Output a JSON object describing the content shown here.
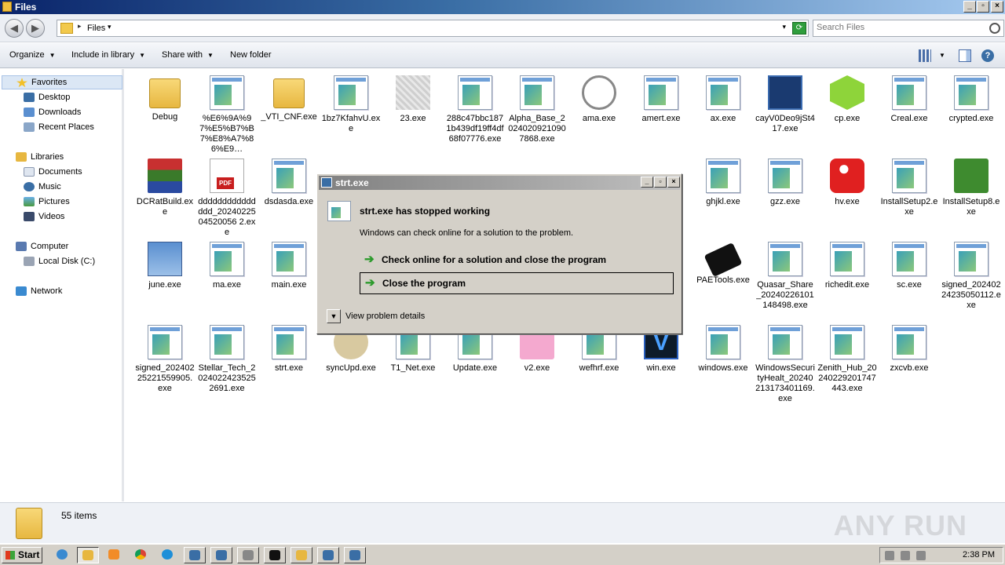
{
  "window": {
    "title": "Files"
  },
  "address": {
    "crumb": "Files",
    "search_placeholder": "Search Files"
  },
  "toolbar": {
    "organize": "Organize",
    "include": "Include in library",
    "share": "Share with",
    "new_folder": "New folder"
  },
  "sidebar": {
    "favorites": "Favorites",
    "desktop": "Desktop",
    "downloads": "Downloads",
    "recent": "Recent Places",
    "libraries": "Libraries",
    "documents": "Documents",
    "music": "Music",
    "pictures": "Pictures",
    "videos": "Videos",
    "computer": "Computer",
    "local_disk": "Local Disk (C:)",
    "network": "Network"
  },
  "files": [
    "Debug",
    "%E6%9A%97%E5%B7%B7%E8%A7%86%E9…",
    "_VTI_CNF.exe",
    "1bz7KfahvU.exe",
    "23.exe",
    "288c47bbc1871b439df19ff4df68f07776.exe",
    "Alpha_Base_20240209210907868.exe",
    "ama.exe",
    "amert.exe",
    "ax.exe",
    "cayV0Deo9jSt417.exe",
    "cp.exe",
    "Creal.exe",
    "crypted.exe",
    "DCRatBuild.exe",
    "ddddddddddddddd_2024022504520056 2.exe",
    "dsdasda.exe",
    "ghjkl.exe",
    "gzz.exe",
    "hv.exe",
    "InstallSetup2.exe",
    "InstallSetup8.exe",
    "june.exe",
    "ma.exe",
    "main.exe",
    "PAETools.exe",
    "Quasar_Share_20240226101148498.exe",
    "richedit.exe",
    "sc.exe",
    "signed_20240224235050112.exe",
    "signed_20240225221559905.exe",
    "Stellar_Tech_20240224235252691.exe",
    "strt.exe",
    "syncUpd.exe",
    "T1_Net.exe",
    "Update.exe",
    "v2.exe",
    "wefhrf.exe",
    "win.exe",
    "windows.exe",
    "WindowsSecurityHealt_20240213173401169.exe",
    "Zenith_Hub_20240229201747443.exe",
    "zxcvb.exe"
  ],
  "status": {
    "items": "55 items",
    "watermark": "ANY RUN"
  },
  "dialog": {
    "title": "strt.exe",
    "heading": "strt.exe has stopped working",
    "sub": "Windows can check online for a solution to the problem.",
    "action1": "Check online for a solution and close the program",
    "action2": "Close the program",
    "details": "View problem details"
  },
  "taskbar": {
    "start": "Start",
    "clock": "2:38 PM"
  }
}
